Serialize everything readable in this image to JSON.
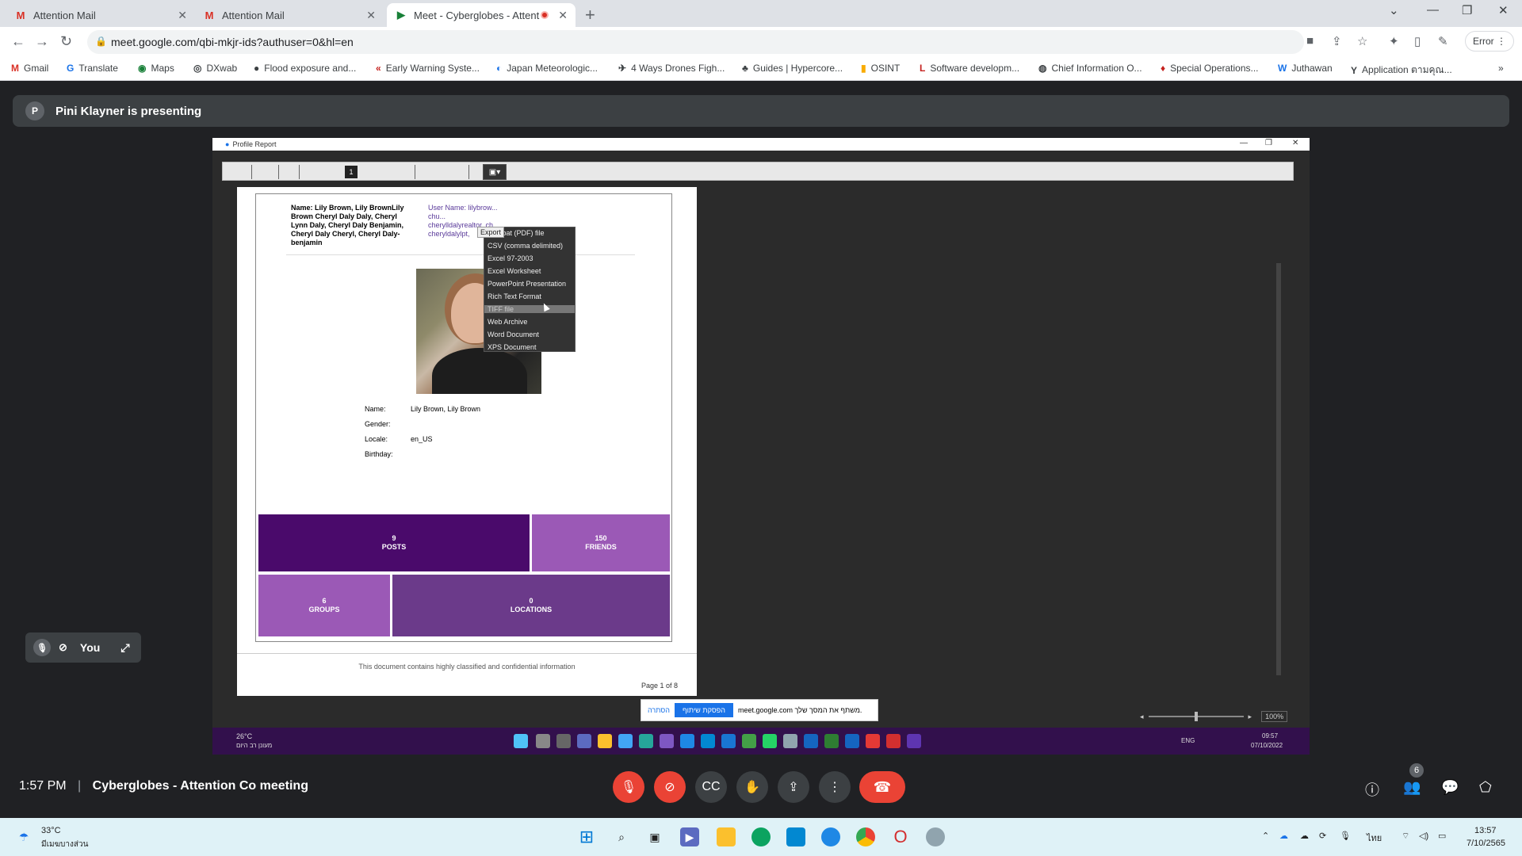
{
  "tabs": [
    {
      "title": "Attention Mail"
    },
    {
      "title": "Attention Mail"
    },
    {
      "title": "Meet - Cyberglobes - Attent"
    }
  ],
  "address": {
    "url": "meet.google.com/qbi-mkjr-ids?authuser=0&hl=en",
    "error_label": "Error"
  },
  "bookmarks": [
    "Gmail",
    "Translate",
    "Maps",
    "DXwab",
    "Flood exposure and...",
    "Early Warning Syste...",
    "Japan Meteorologic...",
    "4 Ways Drones Figh...",
    "Guides | Hypercore...",
    "OSINT",
    "Software developm...",
    "Chief Information O...",
    "Special Operations...",
    "Juthawan",
    "Application ตามคุณ..."
  ],
  "presenter": {
    "initial": "P",
    "banner": "Pini Klayner is presenting"
  },
  "report": {
    "window_title": "Profile Report",
    "page_number": "1",
    "name_line": "Name: Lily Brown, Lily BrownLily Brown Cheryl Daly Daly, Cheryl Lynn Daly, Cheryl Daly Benjamin, Cheryl Daly Cheryl, Cheryl Daly-benjamin",
    "user_line": "User Name: lilybrow... chu... cherylldalyrealtor, ch... cheryldalylpt, cheryl.d... cherylbenjaminrealtor...",
    "fields": [
      {
        "label": "Name:",
        "value": "Lily Brown, Lily Brown"
      },
      {
        "label": "Gender:",
        "value": ""
      },
      {
        "label": "Locale:",
        "value": "en_US"
      },
      {
        "label": "Birthday:",
        "value": ""
      }
    ],
    "tiles": [
      {
        "num": "9",
        "label": "POSTS"
      },
      {
        "num": "150",
        "label": "FRIENDS"
      },
      {
        "num": "6",
        "label": "GROUPS"
      },
      {
        "num": "0",
        "label": "LOCATIONS"
      }
    ],
    "footer": "This document contains highly classified and confidential information",
    "page_of": "Page 1 of 8",
    "export_tip": "Export",
    "export_menu": [
      "Acrobat (PDF) file",
      "CSV (comma delimited)",
      "Excel 97-2003",
      "Excel Worksheet",
      "PowerPoint Presentation",
      "Rich Text Format",
      "TIFF file",
      "Web Archive",
      "Word Document",
      "XPS Document"
    ],
    "zoom": "100%"
  },
  "share_bar": {
    "hide": "הסתרה",
    "stop": "הפסקת שיתוף",
    "msg": "meet.google.com משתף את המסך שלך."
  },
  "inner_taskbar": {
    "temp": "26°C",
    "weather": "מעונן רב היום",
    "lang": "ENG",
    "time": "09:57",
    "date": "07/10/2022"
  },
  "self_view": {
    "label": "You"
  },
  "meeting": {
    "time": "1:57 PM",
    "separator": "|",
    "name": "Cyberglobes - Attention Co meeting",
    "participants": "6"
  },
  "taskbar": {
    "temp": "33°C",
    "weather": "มีเมฆบางส่วน",
    "lang": "ไทย",
    "time": "13:57",
    "date": "7/10/2565"
  },
  "colors": {
    "tile_dark": "#4a0a6b",
    "tile_mid": "#6b3a8a",
    "tile_light": "#9b59b6",
    "end_call": "#ea4335"
  }
}
